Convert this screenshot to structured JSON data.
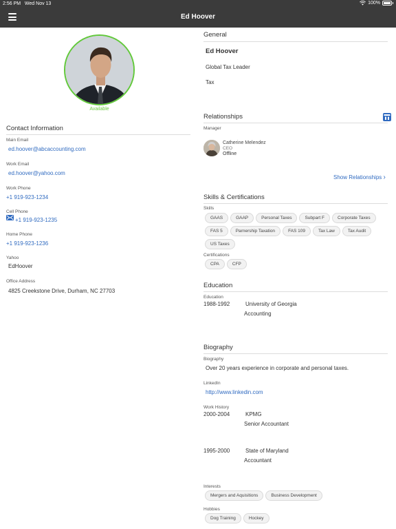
{
  "status": {
    "time": "2:56 PM",
    "date": "Wed Nov 13",
    "battery": "100%"
  },
  "nav": {
    "title": "Ed Hoover"
  },
  "profile": {
    "status": "Available"
  },
  "contact": {
    "title": "Contact Information",
    "main_email_label": "Main Email",
    "main_email": "ed.hoover@abcaccounting.com",
    "work_email_label": "Work Email",
    "work_email": "ed.hoover@yahoo.com",
    "work_phone_label": "Work Phone",
    "work_phone": "+1 919-923-1234",
    "cell_phone_label": "Cell Phone",
    "cell_phone": "+1 919-923-1235",
    "home_phone_label": "Home Phone",
    "home_phone": "+1 919-923-1236",
    "yahoo_label": "Yahoo",
    "yahoo": "EdHoover",
    "office_label": "Office Address",
    "office": "4825 Creekstone Drive, Durham, NC 27703"
  },
  "general": {
    "title": "General",
    "name": "Ed Hoover",
    "job_title": "Global Tax Leader",
    "department": "Tax"
  },
  "relationships": {
    "title": "Relationships",
    "manager_label": "Manager",
    "manager_name": "Catherine Melendez",
    "manager_title": "CEO",
    "manager_status": "Offline",
    "show_label": "Show Relationships"
  },
  "skills": {
    "title": "Skills & Certifications",
    "skills_label": "Skills",
    "skills": [
      "GAAS",
      "GAAP",
      "Personal Taxes",
      "Subpart F",
      "Corporate Taxes",
      "FAS 5",
      "Parnership Taxation",
      "FAS 109",
      "Tax Law",
      "Tax Audit",
      "US Taxes"
    ],
    "cert_label": "Certifications",
    "certs": [
      "CPA",
      "CFP"
    ]
  },
  "education": {
    "title": "Education",
    "label": "Education",
    "years": "1988-1992",
    "school": "University of Georgia",
    "field": "Accounting"
  },
  "biography": {
    "title": "Biography",
    "bio_label": "Biography",
    "bio": "Over 20 years experience in corporate and personal taxes.",
    "linkedin_label": "LinkedIn",
    "linkedin": "http://www.linkedin.com",
    "work_label": "Work History",
    "work": [
      {
        "years": "2000-2004",
        "org": "KPMG",
        "role": "Senior Accountant"
      },
      {
        "years": "1995-2000",
        "org": "State of Maryland",
        "role": "Accountant"
      }
    ],
    "interests_label": "Interests",
    "interests": [
      "Mergers and Aquisitions",
      "Business Development"
    ],
    "hobbies_label": "Hobbies",
    "hobbies": [
      "Dog Training",
      "Hockey"
    ]
  }
}
